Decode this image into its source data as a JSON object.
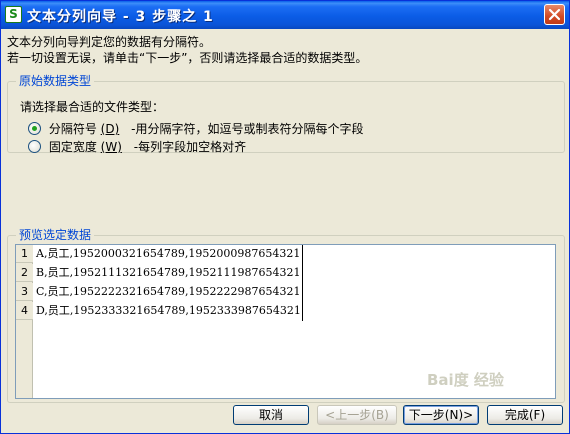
{
  "window": {
    "app_icon_letter": "S",
    "title": "文本分列向导 - 3 步骤之 1",
    "close_icon": "close-icon"
  },
  "intro": {
    "line1": "文本分列向导判定您的数据有分隔符。",
    "line2": "若一切设置无误，请单击“下一步”，否则请选择最合适的数据类型。"
  },
  "data_type_group": {
    "title": "原始数据类型",
    "prompt": "请选择最合适的文件类型：",
    "options": [
      {
        "label": "分隔符号",
        "accel": "(D)",
        "description": "-用分隔字符，如逗号或制表符分隔每个字段",
        "checked": true
      },
      {
        "label": "固定宽度",
        "accel": "(W)",
        "description": "-每列字段加空格对齐",
        "checked": false
      }
    ]
  },
  "preview_group": {
    "title": "预览选定数据",
    "rows": [
      {
        "num": "1",
        "text": "A,员工,1952000321654789,1952000987654321"
      },
      {
        "num": "2",
        "text": "B,员工,1952111321654789,1952111987654321"
      },
      {
        "num": "3",
        "text": "C,员工,1952222321654789,1952222987654321"
      },
      {
        "num": "4",
        "text": "D,员工,1952333321654789,1952333987654321"
      }
    ]
  },
  "buttons": {
    "cancel": "取消",
    "prev": "<上一步(B)",
    "next": "下一步(N)>",
    "finish": "完成(F)"
  },
  "watermark": "Bai度 经验"
}
